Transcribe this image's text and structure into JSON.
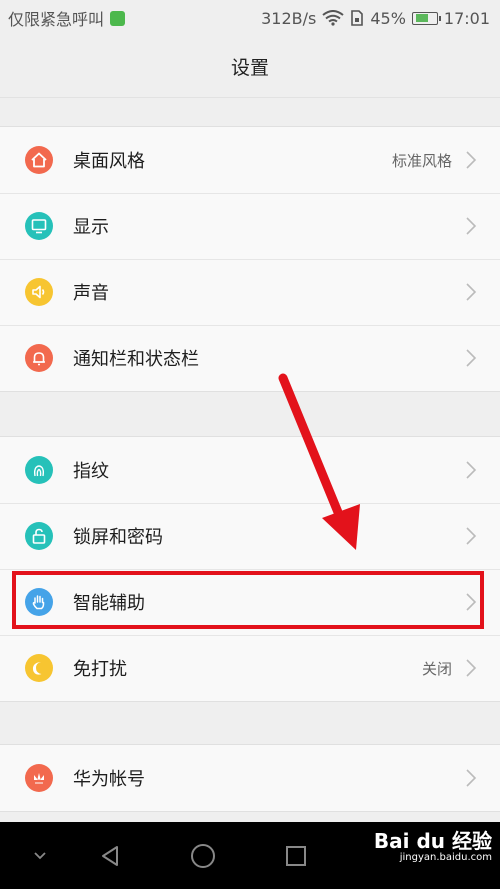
{
  "status_bar": {
    "carrier_text": "仅限紧急呼叫",
    "speed": "312B/s",
    "battery": "45%",
    "time": "17:01"
  },
  "title": "设置",
  "groups": [
    {
      "items": [
        {
          "label": "桌面风格",
          "value": "标准风格",
          "icon": "home-icon",
          "color": "#f2694e"
        },
        {
          "label": "显示",
          "value": "",
          "icon": "display-icon",
          "color": "#26c1b9"
        },
        {
          "label": "声音",
          "value": "",
          "icon": "speaker-icon",
          "color": "#f7c531"
        },
        {
          "label": "通知栏和状态栏",
          "value": "",
          "icon": "bell-icon",
          "color": "#f2694e"
        }
      ]
    },
    {
      "items": [
        {
          "label": "指纹",
          "value": "",
          "icon": "fingerprint-icon",
          "color": "#26c1b9"
        },
        {
          "label": "锁屏和密码",
          "value": "",
          "icon": "lock-icon",
          "color": "#26c1b9"
        },
        {
          "label": "智能辅助",
          "value": "",
          "icon": "hand-icon",
          "color": "#45a3e8"
        },
        {
          "label": "免打扰",
          "value": "关闭",
          "icon": "moon-icon",
          "color": "#f7c531"
        }
      ]
    },
    {
      "items": [
        {
          "label": "华为帐号",
          "value": "",
          "icon": "huawei-icon",
          "color": "#f2694e"
        }
      ]
    }
  ],
  "watermark": {
    "main": "Bai du 经验",
    "sub": "jingyan.baidu.com"
  }
}
